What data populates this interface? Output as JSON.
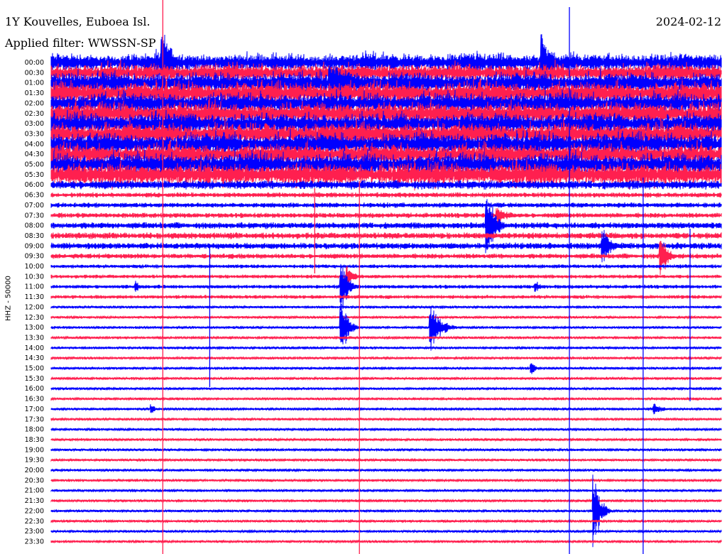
{
  "header": {
    "station": "1Y Kouvelles, Euboea Isl.",
    "filter": "Applied filter: WWSSN-SP",
    "date": "2024-02-12",
    "channel": "HHZ - 50000"
  },
  "colors": {
    "odd_trace": "#0000ff",
    "even_trace": "#ff1f4f",
    "text": "#000000"
  },
  "chart_data": {
    "type": "seismogram (helicorder)",
    "row_labels": [
      "00:00",
      "00:30",
      "01:00",
      "01:30",
      "02:00",
      "02:30",
      "03:00",
      "03:30",
      "04:00",
      "04:30",
      "05:00",
      "05:30",
      "06:00",
      "06:30",
      "07:00",
      "07:30",
      "08:00",
      "08:30",
      "09:00",
      "09:30",
      "10:00",
      "10:30",
      "11:00",
      "11:30",
      "12:00",
      "12:30",
      "13:00",
      "13:30",
      "14:00",
      "14:30",
      "15:00",
      "15:30",
      "16:00",
      "16:30",
      "17:00",
      "17:30",
      "18:00",
      "18:30",
      "19:00",
      "19:30",
      "20:00",
      "20:30",
      "21:00",
      "21:30",
      "22:00",
      "22:30",
      "23:00",
      "23:30"
    ],
    "row_minutes": 30,
    "noise_level": [
      12,
      12,
      14,
      15,
      14,
      15,
      14,
      15,
      15,
      14,
      15,
      15,
      7,
      4,
      4,
      4,
      5,
      5,
      5,
      4,
      3,
      3,
      3,
      3,
      2,
      2,
      2,
      2,
      2,
      2,
      2,
      2,
      2,
      2,
      2,
      2,
      2,
      2,
      2,
      2,
      2,
      2,
      2,
      2,
      2,
      2,
      2,
      2
    ],
    "events": [
      {
        "row": 0,
        "minute": 5.0,
        "amp": 60,
        "dur": 1.2
      },
      {
        "row": 0,
        "minute": 22.0,
        "amp": 60,
        "dur": 1.0
      },
      {
        "row": 2,
        "minute": 12.5,
        "amp": 40,
        "dur": 3.5
      },
      {
        "row": 15,
        "minute": 20.0,
        "amp": 14,
        "dur": 1.5
      },
      {
        "row": 16,
        "minute": 19.5,
        "amp": 60,
        "dur": 1.0
      },
      {
        "row": 18,
        "minute": 24.7,
        "amp": 30,
        "dur": 1.0
      },
      {
        "row": 19,
        "minute": 27.3,
        "amp": 40,
        "dur": 0.8
      },
      {
        "row": 21,
        "minute": 13.3,
        "amp": 18,
        "dur": 0.8
      },
      {
        "row": 22,
        "minute": 13.0,
        "amp": 45,
        "dur": 0.8
      },
      {
        "row": 22,
        "minute": 3.8,
        "amp": 10,
        "dur": 0.6
      },
      {
        "row": 22,
        "minute": 21.7,
        "amp": 10,
        "dur": 0.6
      },
      {
        "row": 26,
        "minute": 13.0,
        "amp": 50,
        "dur": 0.8
      },
      {
        "row": 26,
        "minute": 17.0,
        "amp": 38,
        "dur": 1.2
      },
      {
        "row": 30,
        "minute": 21.5,
        "amp": 12,
        "dur": 0.5
      },
      {
        "row": 34,
        "minute": 27.0,
        "amp": 10,
        "dur": 1.0
      },
      {
        "row": 34,
        "minute": 4.5,
        "amp": 8,
        "dur": 0.5
      },
      {
        "row": 44,
        "minute": 24.3,
        "amp": 60,
        "dur": 0.8
      }
    ]
  }
}
